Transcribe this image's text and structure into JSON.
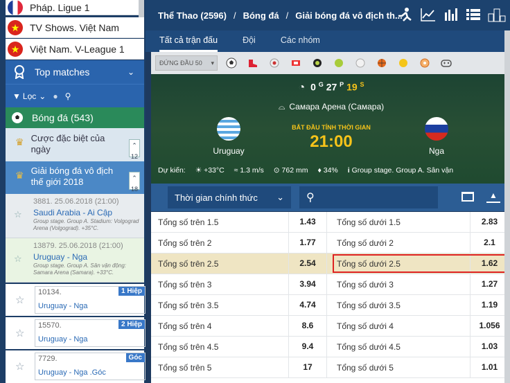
{
  "sidebar": {
    "leagues": [
      {
        "label": "Pháp. Ligue 1",
        "flag": "france"
      },
      {
        "label": "TV Shows. Việt Nam",
        "flag": "vietnam"
      },
      {
        "label": "Việt Nam. V-League 1",
        "flag": "vietnam"
      }
    ],
    "top_matches": "Top matches",
    "filter_label": "Lọc",
    "sport": "Bóng đá (543)",
    "categories": [
      {
        "label": "Cược đặc biệt của ngày",
        "count": "12"
      },
      {
        "label": "Giải bóng đá vô địch thế giới 2018",
        "count": "18"
      }
    ],
    "matches": [
      {
        "line1": "3881. 25.06.2018 (21:00)",
        "teams": "Saudi Arabia - Ai Cập",
        "info": "Group stage. Group A. Stadium: Volgograd Arena (Volgograd). +35°C."
      },
      {
        "line1": "13879. 25.06.2018 (21:00)",
        "teams": "Uruguay - Nga",
        "info": "Group stage. Group A. Sân vận động: Samara Arena (Samara). +33°C."
      }
    ],
    "halves": [
      {
        "id": "10134.",
        "teams": "Uruguay - Nga",
        "tag": "1 Hiệp"
      },
      {
        "id": "15570.",
        "teams": "Uruguay - Nga",
        "tag": "2 Hiệp"
      },
      {
        "id": "7729.",
        "teams": "Uruguay - Nga .Góc",
        "tag": "Góc"
      }
    ]
  },
  "breadcrumb": {
    "a": "Thể Thao (2596)",
    "b": "Bóng đá",
    "c": "Giải bóng đá vô địch th..."
  },
  "tabs": [
    "Tất cả trận đấu",
    "Đội",
    "Các nhóm"
  ],
  "dropdown": "ĐỨNG ĐẦU 50",
  "match": {
    "timer_value": "0",
    "timer_g": "G",
    "timer_min": "27",
    "timer_p": "P",
    "timer_sec": "19",
    "timer_s": "S",
    "venue": "Самара Арена (Самара)",
    "home": "Uruguay",
    "away": "Nga",
    "kick_label": "BẮT ĐẦU TÍNH THỜI GIAN",
    "kick_time": "21:00",
    "forecast_label": "Dự kiến:",
    "temp": "+33°C",
    "wind": "1.3 m/s",
    "pressure": "762 mm",
    "humidity": "34%",
    "info": "Group stage. Group A. Sân vận"
  },
  "period_select": "Thời gian chính thức",
  "odds": [
    {
      "over": "Tổng số trên 1.5",
      "ov": "1.43",
      "under": "Tổng số dưới 1.5",
      "uv": "2.83"
    },
    {
      "over": "Tổng số trên 2",
      "ov": "1.77",
      "under": "Tổng số dưới 2",
      "uv": "2.1"
    },
    {
      "over": "Tổng số trên 2.5",
      "ov": "2.54",
      "under": "Tổng số dưới 2.5",
      "uv": "1.62"
    },
    {
      "over": "Tổng số trên 3",
      "ov": "3.94",
      "under": "Tổng số dưới 3",
      "uv": "1.27"
    },
    {
      "over": "Tổng số trên 3.5",
      "ov": "4.74",
      "under": "Tổng số dưới 3.5",
      "uv": "1.19"
    },
    {
      "over": "Tổng số trên 4",
      "ov": "8.6",
      "under": "Tổng số dưới 4",
      "uv": "1.056"
    },
    {
      "over": "Tổng số trên 4.5",
      "ov": "9.4",
      "under": "Tổng số dưới 4.5",
      "uv": "1.03"
    },
    {
      "over": "Tổng số trên 5",
      "ov": "17",
      "under": "Tổng số dưới 5",
      "uv": "1.01"
    }
  ],
  "highlight_row": 2,
  "colors": {
    "header": "#1c426e",
    "accent": "#2a64ad",
    "highlight": "#efe5c3",
    "timer": "#f6c31a"
  }
}
